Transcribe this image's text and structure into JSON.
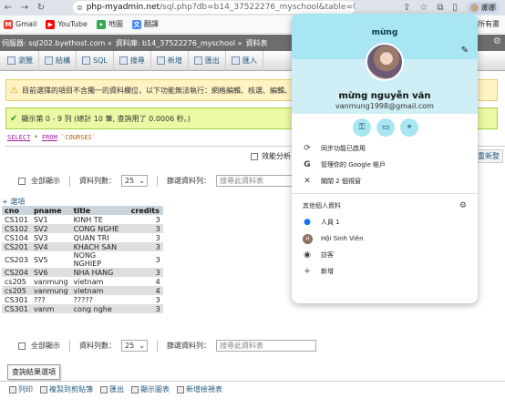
{
  "browser": {
    "url_host": "php-myadmin.net",
    "url_path": "/sql.php?db=b14_37522276_myschool&table=C...",
    "profile_label": "娜娜"
  },
  "bookmarks": [
    {
      "label": "Gmail"
    },
    {
      "label": "YouTube"
    },
    {
      "label": "地圖"
    },
    {
      "label": "翻譯"
    }
  ],
  "bookmarks_right": "所有書",
  "pma": {
    "breadcrumb": [
      "伺服器: sql202.byethost.com »",
      "資料庫: b14_37522276_myschool »",
      "資料表"
    ],
    "tabs": [
      "瀏覽",
      "結構",
      "SQL",
      "搜尋",
      "新增",
      "匯出",
      "匯入"
    ],
    "warning": "目前選擇的項目不含獨一的資料欄位，以下功能無法執行：網格編輯、核選、編輯、",
    "success": "顯示第 0 - 9 列 (總計 10 筆, 查詢用了 0.0006 秒。)",
    "sql": {
      "select": "SELECT",
      "star": " * ",
      "from": "FROM",
      "table": " `COURSES`"
    },
    "profiling": "效能分析",
    "refresh": "重新整",
    "show_all": "全部顯示",
    "row_count_label": "資料列數：",
    "row_count": "25",
    "filter_label": "篩選資料列：",
    "filter_placeholder": "搜尋此資料表",
    "options_link": "+ 選項",
    "tooltip": "查詢結果選項",
    "bottom_actions": [
      "列印",
      "複製到剪貼簿",
      "匯出",
      "顯示圖表",
      "新增檢視表"
    ]
  },
  "table": {
    "columns": [
      "cno",
      "pname",
      "title",
      "credits"
    ],
    "rows": [
      [
        "CS101",
        "SV1",
        "KINH TE",
        "3"
      ],
      [
        "CS102",
        "SV2",
        "CONG NGHE",
        "3"
      ],
      [
        "CS104",
        "SV3",
        "QUAN TRI",
        "3"
      ],
      [
        "CS201",
        "SV4",
        "KHACH SAN",
        "3"
      ],
      [
        "CS203",
        "SV5",
        "NONG NGHIEP",
        "3"
      ],
      [
        "CS204",
        "SV6",
        "NHA HANG",
        "3"
      ],
      [
        "cs205",
        "vanmung",
        "vietnam",
        "4"
      ],
      [
        "cs205",
        "vanmung",
        "vietnam",
        "4"
      ],
      [
        "CS301",
        "???",
        "?????",
        "3"
      ],
      [
        "CS301",
        "vanm",
        "cong nghe",
        "3"
      ]
    ]
  },
  "profile_popup": {
    "name_short": "mừng",
    "full_name": "mừng nguyễn văn",
    "email": "vanmung1998@gmail.com",
    "quick_icons": [
      "key-icon",
      "card-icon",
      "location-icon"
    ],
    "items": [
      {
        "icon": "sync-icon",
        "label": "同步功能已啟用"
      },
      {
        "icon": "google-icon",
        "label": "管理你的 Google 帳戶"
      },
      {
        "icon": "close-icon",
        "label": "關閉 2 個視窗"
      }
    ],
    "other_profiles_label": "其他個人資料",
    "profiles": [
      {
        "icon": "person-icon",
        "label": "人員 1"
      },
      {
        "icon": "avatar-h",
        "label": "Hội Sinh Viên"
      },
      {
        "icon": "guest-icon",
        "label": "訪客"
      },
      {
        "icon": "plus-icon",
        "label": "新增"
      }
    ]
  },
  "colors": {
    "popup_header": "#a9e6f3",
    "pma_breadcrumb": "#6d6d6d",
    "success_bg": "#ebf8a4",
    "warning_bg": "#fff3c4"
  }
}
